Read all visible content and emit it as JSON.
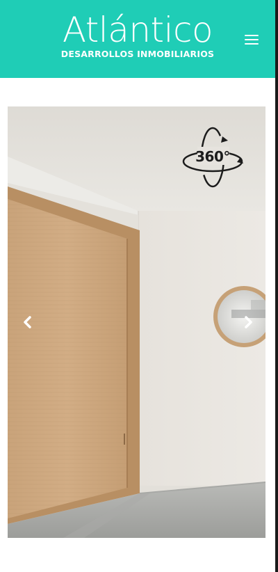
{
  "header": {
    "brand_name": "Atlántico",
    "brand_subtitle": "DESARROLLOS INMOBILIARIOS",
    "menu_icon": "hamburger-menu-icon",
    "background_color": "#1fcdb6"
  },
  "gallery": {
    "badge_label": "360°",
    "badge_icon": "rotate-360-icon",
    "prev_icon": "chevron-left-icon",
    "next_icon": "chevron-right-icon"
  }
}
